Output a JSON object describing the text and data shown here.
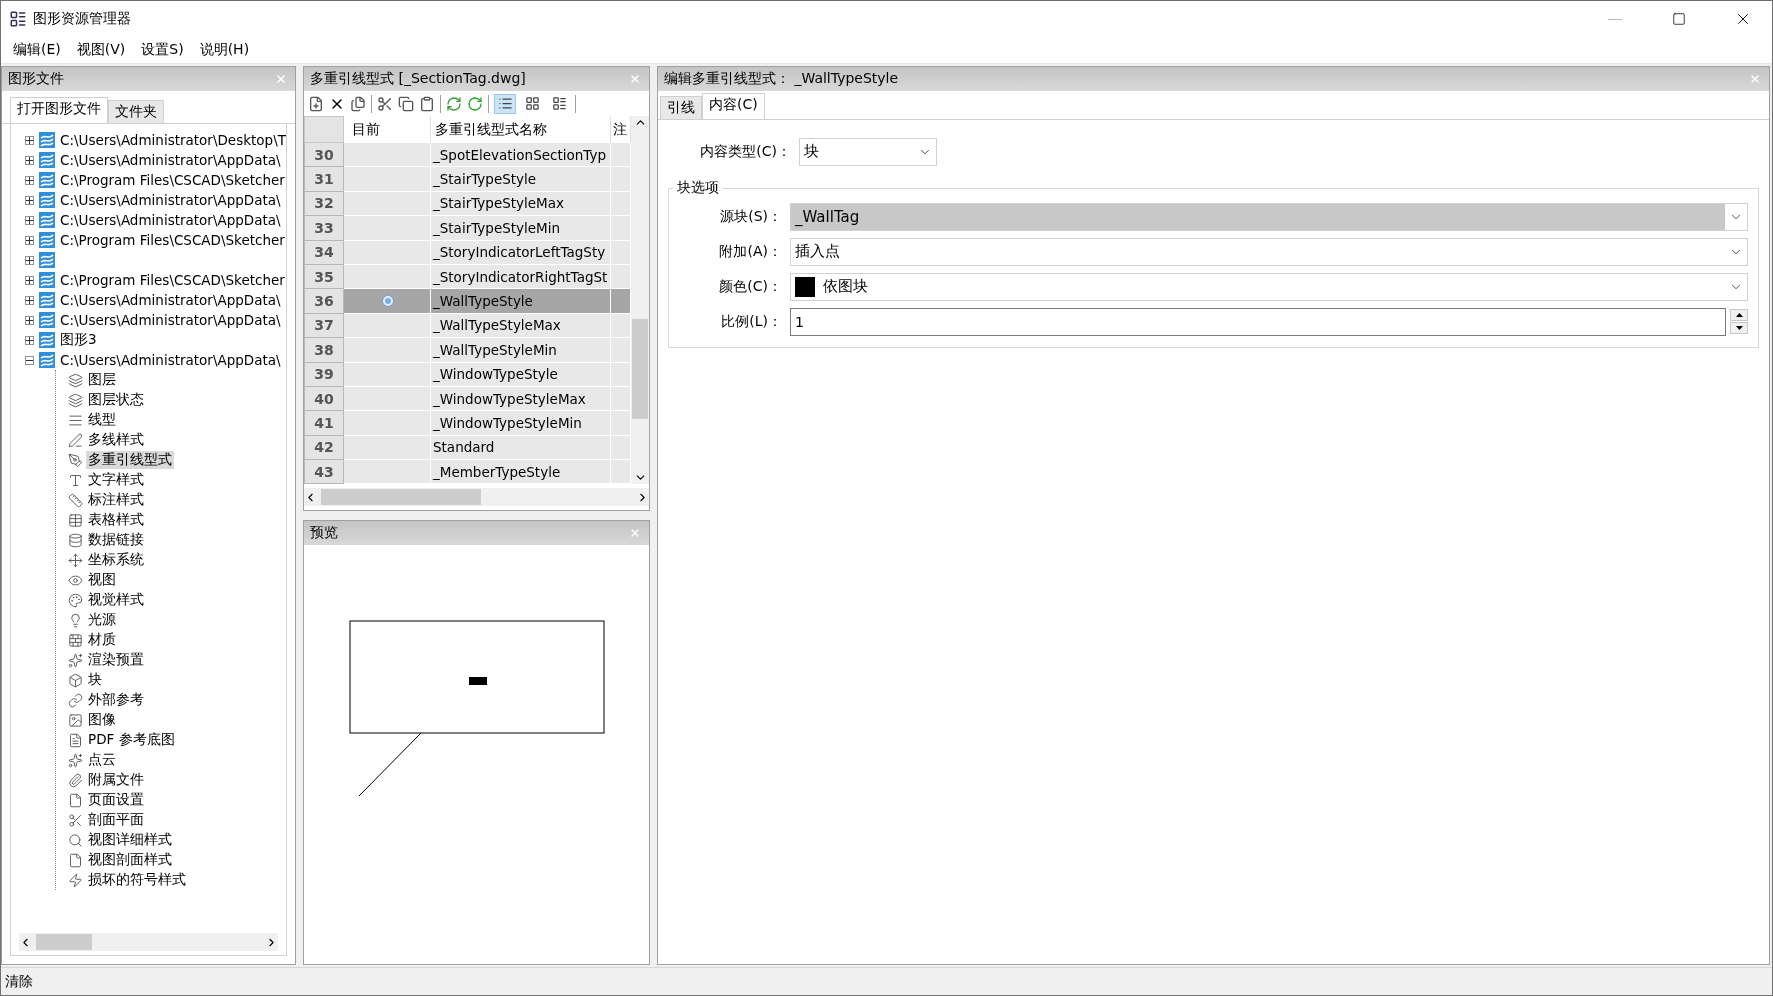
{
  "window": {
    "title": "图形资源管理器"
  },
  "menu": [
    "编辑(E)",
    "视图(V)",
    "设置S)",
    "说明(H)"
  ],
  "drawing_files_panel": {
    "title": "图形文件",
    "tabs": [
      {
        "label": "打开图形文件",
        "selected": true
      },
      {
        "label": "文件夹",
        "selected": false
      }
    ],
    "tree": [
      {
        "label": "C:\\Users\\Administrator\\Desktop\\T",
        "expanded": false
      },
      {
        "label": "C:\\Users\\Administrator\\AppData\\",
        "expanded": false
      },
      {
        "label": "C:\\Program Files\\CSCAD\\Sketcher",
        "expanded": false
      },
      {
        "label": "C:\\Users\\Administrator\\AppData\\",
        "expanded": false
      },
      {
        "label": "C:\\Users\\Administrator\\AppData\\",
        "expanded": false
      },
      {
        "label": "C:\\Program Files\\CSCAD\\Sketcher",
        "expanded": false
      },
      {
        "expanded": false
      },
      {
        "label": "C:\\Program Files\\CSCAD\\Sketcher",
        "expanded": false
      },
      {
        "label": "C:\\Users\\Administrator\\AppData\\",
        "expanded": false
      },
      {
        "label": "C:\\Users\\Administrator\\AppData\\",
        "expanded": false
      },
      {
        "label": "图形3",
        "expanded": false
      },
      {
        "label": "C:\\Users\\Administrator\\AppData\\",
        "expanded": true,
        "children": [
          {
            "label": "图层",
            "selected": false
          },
          {
            "label": "图层状态",
            "selected": false
          },
          {
            "label": "线型",
            "selected": false
          },
          {
            "label": "多线样式",
            "selected": false
          },
          {
            "label": "多重引线型式",
            "selected": true
          },
          {
            "label": "文字样式",
            "selected": false
          },
          {
            "label": "标注样式",
            "selected": false
          },
          {
            "label": "表格样式",
            "selected": false
          },
          {
            "label": "数据链接",
            "selected": false
          },
          {
            "label": "坐标系统",
            "selected": false
          },
          {
            "label": "视图",
            "selected": false
          },
          {
            "label": "视觉样式",
            "selected": false
          },
          {
            "label": "光源",
            "selected": false
          },
          {
            "label": "材质",
            "selected": false
          },
          {
            "label": "渲染预置",
            "selected": false
          },
          {
            "label": "块",
            "selected": false
          },
          {
            "label": "外部参考",
            "selected": false
          },
          {
            "label": "图像",
            "selected": false
          },
          {
            "label": "PDF 参考底图",
            "selected": false
          },
          {
            "label": "点云",
            "selected": false
          },
          {
            "label": "附属文件",
            "selected": false
          },
          {
            "label": "页面设置",
            "selected": false
          },
          {
            "label": "剖面平面",
            "selected": false
          },
          {
            "label": "视图详细样式",
            "selected": false
          },
          {
            "label": "视图剖面样式",
            "selected": false
          },
          {
            "label": "损坏的符号样式",
            "selected": false
          }
        ]
      }
    ]
  },
  "styles_panel": {
    "title": "多重引线型式 [_SectionTag.dwg]",
    "view_buttons": [
      {
        "selected": true
      },
      {
        "selected": false
      },
      {
        "selected": false
      }
    ],
    "columns": [
      "目前",
      "多重引线型式名称",
      "注"
    ],
    "rows": [
      {
        "number": "30",
        "name": "_SpotElevationSectionTyp",
        "current": false,
        "selected": false
      },
      {
        "number": "31",
        "name": "_StairTypeStyle",
        "current": false,
        "selected": false
      },
      {
        "number": "32",
        "name": "_StairTypeStyleMax",
        "current": false,
        "selected": false
      },
      {
        "number": "33",
        "name": "_StairTypeStyleMin",
        "current": false,
        "selected": false
      },
      {
        "number": "34",
        "name": "_StoryIndicatorLeftTagSty",
        "current": false,
        "selected": false
      },
      {
        "number": "35",
        "name": "_StoryIndicatorRightTagSt",
        "current": false,
        "selected": false
      },
      {
        "number": "36",
        "name": "_WallTypeStyle",
        "current": true,
        "selected": true
      },
      {
        "number": "37",
        "name": "_WallTypeStyleMax",
        "current": false,
        "selected": false
      },
      {
        "number": "38",
        "name": "_WallTypeStyleMin",
        "current": false,
        "selected": false
      },
      {
        "number": "39",
        "name": "_WindowTypeStyle",
        "current": false,
        "selected": false
      },
      {
        "number": "40",
        "name": "_WindowTypeStyleMax",
        "current": false,
        "selected": false
      },
      {
        "number": "41",
        "name": "_WindowTypeStyleMin",
        "current": false,
        "selected": false
      },
      {
        "number": "42",
        "name": "Standard",
        "current": false,
        "selected": false
      },
      {
        "number": "43",
        "name": "_MemberTypeStyle",
        "current": false,
        "selected": false
      }
    ]
  },
  "preview_panel": {
    "title": "预览"
  },
  "edit_panel": {
    "title": "编辑多重引线型式： _WallTypeStyle",
    "tabs": [
      {
        "label": "引线",
        "selected": false
      },
      {
        "label": "内容(C)",
        "selected": true
      }
    ],
    "content_type": {
      "label": "内容类型(C)：",
      "value": "块"
    },
    "group": {
      "title": "块选项",
      "fields": [
        {
          "kind": "dropdown",
          "label": "源块(S)：",
          "value": "_WallTag",
          "highlighted": true
        },
        {
          "kind": "dropdown",
          "label": "附加(A)：",
          "value": "插入点",
          "highlighted": false
        },
        {
          "kind": "color",
          "label": "颜色(C)：",
          "value": "依图块",
          "color": "#000000"
        },
        {
          "kind": "spinner",
          "label": "比例(L)：",
          "value": "1"
        }
      ]
    }
  },
  "status_bar": {
    "text": "清除"
  }
}
